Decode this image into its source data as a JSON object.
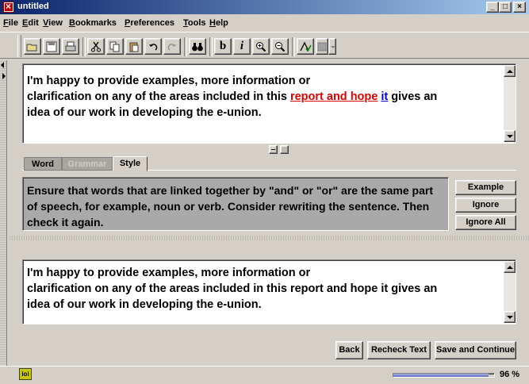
{
  "window": {
    "title": "untitled",
    "min_label": "_",
    "max_label": "□",
    "close_label": "×"
  },
  "menu": [
    {
      "label": "File",
      "key": "F"
    },
    {
      "label": "Edit",
      "key": "E"
    },
    {
      "label": "View",
      "key": "V"
    },
    {
      "label": "Bookmarks",
      "key": "B"
    },
    {
      "label": "Preferences",
      "key": "P"
    },
    {
      "label": "Tools",
      "key": "T"
    },
    {
      "label": "Help",
      "key": "H"
    }
  ],
  "toolbar": {
    "open": "open-icon",
    "save": "save-icon",
    "print": "print-icon",
    "cut": "cut-icon",
    "copy": "copy-icon",
    "paste": "paste-icon",
    "undo": "undo-icon",
    "redo": "redo-icon",
    "find": "binoculars-icon",
    "bold_label": "b",
    "italic_label": "i",
    "zoom_in": "zoom-in-icon",
    "zoom_out": "zoom-out-icon",
    "spell": "spellcheck-icon",
    "more": "dropdown-icon"
  },
  "editor": {
    "line1": "I'm happy to provide examples, more information or",
    "line2_pre": "clarification on any of the areas included in this ",
    "error_phrase": "report and hope",
    "line2_mid": " ",
    "error_word": "it",
    "line2_post": " gives an",
    "line3": "idea of our work in developing the e-union."
  },
  "tabs": [
    {
      "label": "Word",
      "state": "inactive"
    },
    {
      "label": "Grammar",
      "state": "disabled"
    },
    {
      "label": "Style",
      "state": "active"
    }
  ],
  "suggestion": {
    "text": "Ensure that words that are linked together by \"and\" or \"or\" are the same part of speech, for example, noun or verb. Consider rewriting the sentence. Then check it again.",
    "example_label": "Example",
    "ignore_label": "Ignore",
    "ignore_all_label": "Ignore All"
  },
  "preview": {
    "line1": "I'm happy to provide examples, more information or",
    "line2": "clarification on any of the areas included in this report and hope it gives an",
    "line3": "idea of our work in developing the e-union."
  },
  "actions": {
    "back_label": "Back",
    "recheck_label": "Recheck Text",
    "save_continue_label": "Save and Continue"
  },
  "status": {
    "icon_text": "ioi",
    "progress_fraction": 0.96,
    "progress_label": "96 %",
    "progress_color": "#5a6cc0"
  }
}
